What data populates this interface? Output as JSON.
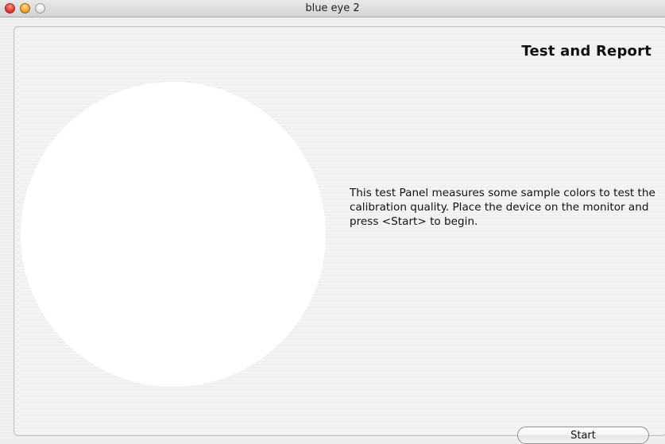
{
  "window": {
    "title": "blue eye 2"
  },
  "panel": {
    "title": "Test and Report",
    "description": "This test Panel measures some sample colors to test the calibration quality. Place the device on the monitor and press <Start> to begin.",
    "start_label": "Start"
  },
  "colors": {
    "test_patch": "#ffffff",
    "close_button": "#e0443a",
    "minimize_button": "#f2a93a",
    "zoom_button": "#e6e6e6"
  }
}
